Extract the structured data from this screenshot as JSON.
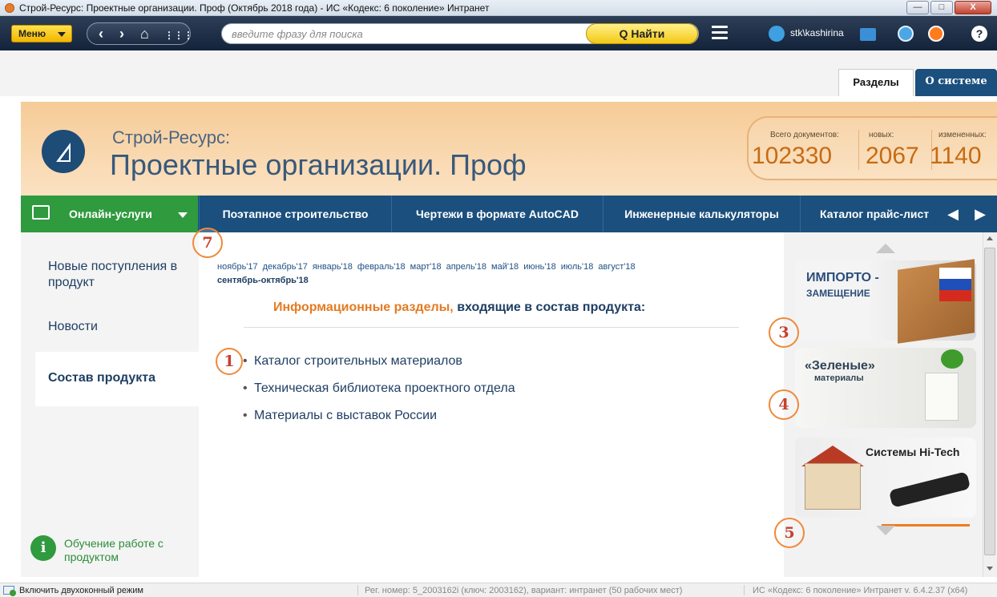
{
  "window": {
    "title": "Строй-Ресурс: Проектные организации. Проф (Октябрь 2018 года) - ИС «Кодекс: 6 поколение» Интранет",
    "minimize": "—",
    "maximize": "□",
    "close": "X"
  },
  "toolbar": {
    "menu_label": "Меню",
    "nav_back": "‹",
    "nav_forward": "›",
    "nav_home": "⌂",
    "nav_grid": "⋮⋮⋮",
    "search_placeholder": "введите фразу для поиска",
    "find_label": "Q Найти",
    "username": "stk\\kashirina",
    "help": "?"
  },
  "top_tabs": {
    "sections": "Разделы",
    "about": "О системе"
  },
  "banner": {
    "line1": "Строй-Ресурс:",
    "line2": "Проектные организации. Проф",
    "stats": {
      "total_label": "Всего документов:",
      "total_value": "102330",
      "new_label": "новых:",
      "new_value": "2067",
      "changed_label": "измененных:",
      "changed_value": "1140"
    }
  },
  "nav": {
    "online": "Онлайн-услуги",
    "items": [
      "Поэтапное строительство",
      "Чертежи в формате AutoCAD",
      "Инженерные калькуляторы",
      "Каталог прайс-лист"
    ],
    "prev": "◀",
    "next": "▶"
  },
  "left_nav": {
    "new_arrivals": "Новые поступления в продукт",
    "news": "Новости",
    "composition": "Состав продукта",
    "training": "Обучение работе с продуктом",
    "info_icon": "i"
  },
  "main": {
    "months": [
      "ноябрь'17",
      "декабрь'17",
      "январь'18",
      "февраль'18",
      "март'18",
      "апрель'18",
      "май'18",
      "июнь'18",
      "июль'18",
      "август'18"
    ],
    "current_month": "сентябрь-октябрь'18",
    "title_orange": "Информационные разделы,",
    "title_blue": "входящие в состав продукта:",
    "sections": [
      "Каталог строительных материалов",
      "Техническая библиотека проектного отдела",
      "Материалы с выставок России"
    ],
    "bullet": "•"
  },
  "promos": {
    "import_line1": "ИМПОРТО -",
    "import_line2": "ЗАМЕЩЕНИЕ",
    "green_line1": "«Зеленые»",
    "green_line2": "материалы",
    "hitech": "Системы Hi-Tech"
  },
  "annotations": [
    "7",
    "1",
    "3",
    "4",
    "5"
  ],
  "statusbar": {
    "two_window": "Включить двухоконный режим",
    "reg": "Рег. номер: 5_2003162i (ключ: 2003162), вариант: интранет (50 рабочих мест)",
    "version": "ИС «Кодекс: 6 поколение» Интранет v. 6.4.2.37 (x64)"
  },
  "colors": {
    "accent_orange": "#e37b23",
    "nav_blue": "#1b4f7d",
    "online_green": "#2f9a3e",
    "title_blue": "#1f3e63"
  }
}
